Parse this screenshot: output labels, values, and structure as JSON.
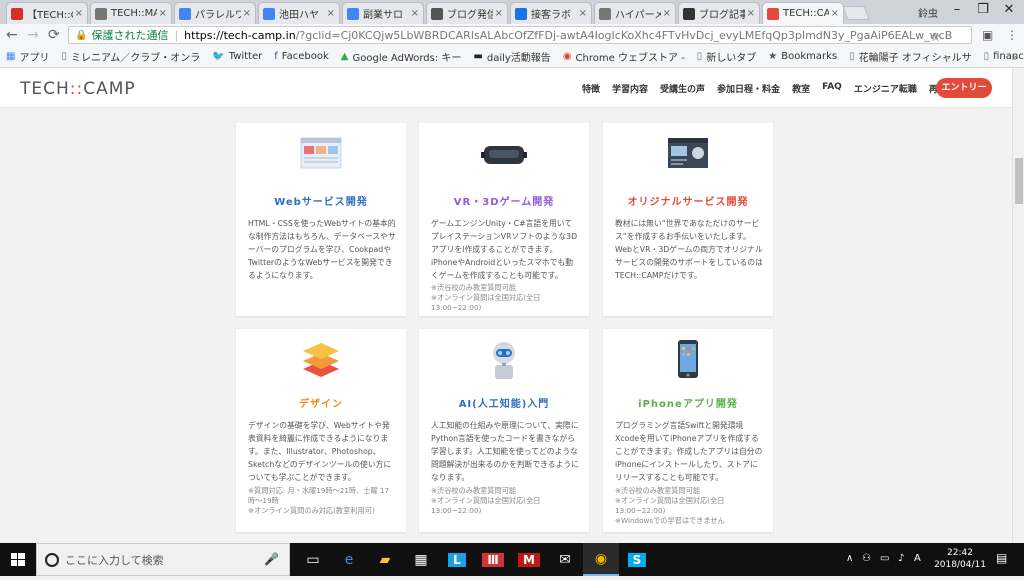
{
  "browser": {
    "tabs": [
      {
        "title": "【TECH::CA",
        "favicon": "gmail-icon",
        "color": "#d93025"
      },
      {
        "title": "TECH::MA",
        "favicon": "page-icon",
        "color": "#777777"
      },
      {
        "title": "パラレルワ",
        "favicon": "google-icon",
        "color": "#4285f4"
      },
      {
        "title": "池田ハヤ",
        "favicon": "google-icon",
        "color": "#4285f4"
      },
      {
        "title": "副業サロ",
        "favicon": "google-icon",
        "color": "#4285f4"
      },
      {
        "title": "ブログ発信",
        "favicon": "pin-icon",
        "color": "#555555"
      },
      {
        "title": "接客ラボ",
        "favicon": "globe-icon",
        "color": "#1a73e8"
      },
      {
        "title": "ハイパーメ",
        "favicon": "page-icon",
        "color": "#777777"
      },
      {
        "title": "ブログ記事",
        "favicon": "info-icon",
        "color": "#333333"
      },
      {
        "title": "TECH::CA",
        "favicon": "techcamp-icon",
        "color": "#e14b3a",
        "active": true
      }
    ],
    "window_user": "鈴虫",
    "nav": {
      "back": "←",
      "forward": "→",
      "reload": "⟳"
    },
    "address": {
      "secure_label": "保護された通信",
      "host": "https://tech-camp.in",
      "path": "/?gclid=Cj0KCQjw5LbWBRDCARIsALAbcOfZfFDj-awtA4IogIcKoXhc4FTvHvDcj_evyLMEfqQp3pImdN3y_PgaAiP6EALw_wcB"
    },
    "bookmarks": [
      {
        "label": "アプリ",
        "icon": "apps-icon"
      },
      {
        "label": "ミレニアム／クラブ・オンラ",
        "icon": "page-icon"
      },
      {
        "label": "Twitter",
        "icon": "twitter-icon"
      },
      {
        "label": "Facebook",
        "icon": "facebook-icon"
      },
      {
        "label": "Google AdWords: キー",
        "icon": "adwords-icon"
      },
      {
        "label": "daily活動報告",
        "icon": "bar-icon"
      },
      {
        "label": "Chrome ウェブストア - ",
        "icon": "chrome-icon"
      },
      {
        "label": "新しいタブ",
        "icon": "page-icon"
      },
      {
        "label": "Bookmarks",
        "icon": "star-icon"
      },
      {
        "label": "花輪陽子 オフィシャルサ",
        "icon": "page-icon"
      },
      {
        "label": "financialwisdom.jp |",
        "icon": "page-icon"
      }
    ]
  },
  "site": {
    "logo_left": "TECH",
    "logo_colon": "::",
    "logo_right": "CAMP",
    "nav": [
      "特徴",
      "学習内容",
      "受講生の声",
      "参加日程・料金",
      "教室",
      "FAQ",
      "エンジニア転職",
      "再受講はこちら"
    ],
    "entry_label": "エントリー",
    "cards": [
      {
        "title": "Webサービス開発",
        "title_color": "#2f6fc2",
        "icon": "browser-window-icon",
        "body": "HTML・CSSを使ったWebサイトの基本的な制作方法はもちろん、データベースやサーバーのプログラムを学び、CookpadやTwitterのようなWebサービスを開発できるようになります。",
        "note": ""
      },
      {
        "title": "VR・3Dゲーム開発",
        "title_color": "#8e5cd9",
        "icon": "vr-headset-icon",
        "body": "ゲームエンジンUnity・C#言語を用いてプレイステーションVRソフトのような3DアプリをI作成することができます。iPhoneやAndroidといったスマホでも動くゲームを作成することも可能です。",
        "note": "※渋谷校のみ教室質問可能\n※オンライン質問は全国対応(全日13:00~22:00)"
      },
      {
        "title": "オリジナルサービス開発",
        "title_color": "#e14b3a",
        "icon": "original-service-icon",
        "body": "教材には無い“世界であなただけのサービス”を作成するお手伝いをいたします。WebとVR・3Dゲームの両方でオリジナルサービスの開発のサポートをしているのはTECH::CAMPだけです。",
        "note": ""
      },
      {
        "title": "デザイン",
        "title_color": "#f08a24",
        "icon": "layers-icon",
        "body": "デザインの基礎を学び、Webサイトや発表資料を綺麗に作成できるようになります。また、Illustrator、Photoshop、Sketchなどのデザインツールの使い方についても学ぶことができます。",
        "note": "※質問対応: 月・水曜19時〜21時、土曜 17時〜19時\n※オンライン質問のみ対応(教室利用可)"
      },
      {
        "title": "AI(人工知能)入門",
        "title_color": "#2f6fc2",
        "icon": "robot-icon",
        "body": "人工知能の仕組みや原理について、実際にPython言語を使ったコードを書きながら学習します。人工知能を使ってどのような問題解決が出来るのかを判断できるようになります。",
        "note": "※渋谷校のみ教室質問可能\n※オンライン質問は全国対応(全日13:00~22:00)"
      },
      {
        "title": "iPhoneアプリ開発",
        "title_color": "#5ab04a",
        "icon": "iphone-icon",
        "body": "プログラミング言語Swiftと開発環境Xcodeを用いてiPhoneアプリを作成することができます。作成したアプリは自分のiPhoneにインストールしたり、ストアにリリースすることも可能です。",
        "note": "※渋谷校のみ教室質問可能\n※オンライン質問は全国対応(全日13:00~22:00)\n※Windowsでの学習はできません"
      }
    ]
  },
  "taskbar": {
    "search_placeholder": "ここに入力して検索",
    "apps": [
      "task-view-icon",
      "edge-icon",
      "file-explorer-icon",
      "store-icon",
      "l-app-icon",
      "grid-app-icon",
      "mcafee-icon",
      "mail-icon",
      "chrome-icon",
      "skype-icon"
    ],
    "time": "22:42",
    "date": "2018/04/11",
    "tray_caret": "∧"
  }
}
